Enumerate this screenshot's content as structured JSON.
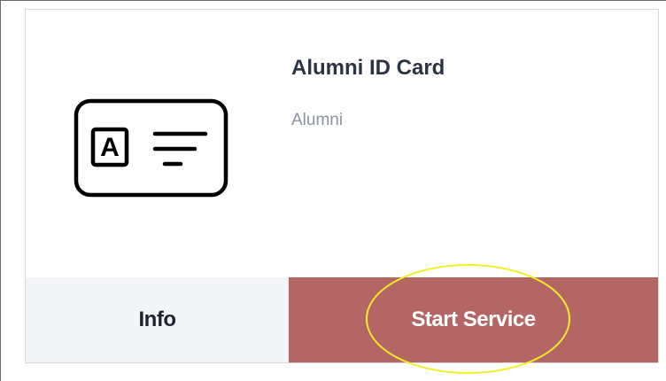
{
  "card": {
    "title": "Alumni ID Card",
    "subtitle": "Alumni",
    "icon": "id-card-icon",
    "icon_letter": "A"
  },
  "actions": {
    "info_label": "Info",
    "start_label": "Start Service"
  },
  "colors": {
    "title": "#2c3444",
    "subtitle": "#8b93a1",
    "info_bg": "#f3f4f7",
    "start_bg": "#b36664",
    "start_text": "#ffffff",
    "highlight": "#f3ee27"
  }
}
